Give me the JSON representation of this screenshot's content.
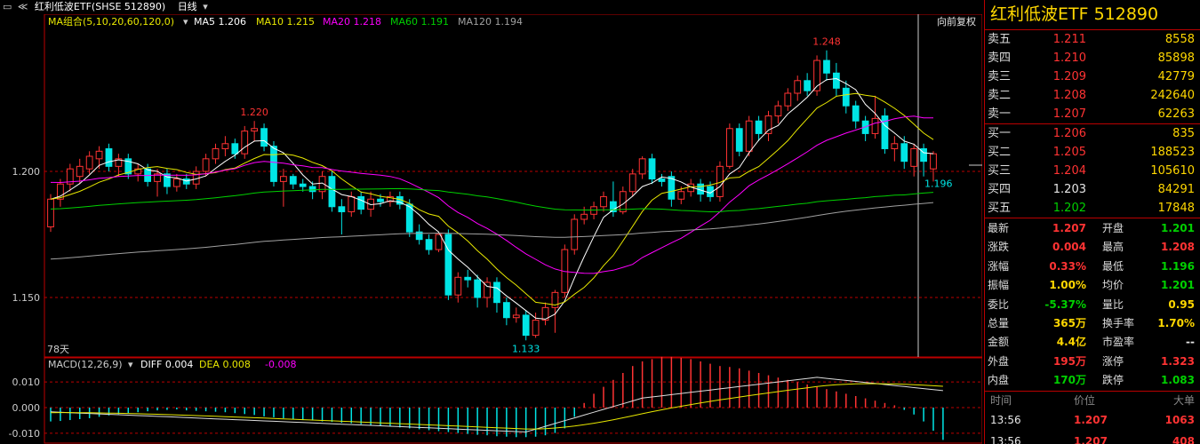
{
  "topbar": {
    "title": "红利低波ETF(SHSE 512890)",
    "period": "日线",
    "ma_group": "MA组合(5,10,20,60,120,0)",
    "ma5": "MA5 1.206",
    "ma10": "MA10 1.215",
    "ma20": "MA20 1.218",
    "ma60": "MA60 1.191",
    "ma120": "MA120 1.194",
    "adjust": "向前复权"
  },
  "chart": {
    "y_labels": [
      "1.200",
      "1.150"
    ],
    "max_label": "1.248",
    "left_high_label": "1.220",
    "min_label": "1.133",
    "last_label": "1.196",
    "days_label": "78天",
    "macd_title": "MACD(12,26,9)",
    "diff": "DIFF 0.004",
    "dea": "DEA 0.008",
    "macd": "-0.008",
    "macd_y": [
      "0.010",
      "0.000",
      "-0.010"
    ],
    "colors": {
      "up": "#ff3333",
      "down": "#00e5e5",
      "ma5": "#ffffff",
      "ma10": "#e8e800",
      "ma20": "#ff00ff",
      "ma60": "#00d000",
      "ma120": "#a0a0a0"
    }
  },
  "chart_data": {
    "type": "candlestick",
    "candles": [
      [
        1.178,
        1.189,
        1.191,
        1.176
      ],
      [
        1.189,
        1.195,
        1.197,
        1.186
      ],
      [
        1.195,
        1.201,
        1.203,
        1.192
      ],
      [
        1.198,
        1.202,
        1.205,
        1.195
      ],
      [
        1.201,
        1.206,
        1.208,
        1.199
      ],
      [
        1.205,
        1.208,
        1.21,
        1.201
      ],
      [
        1.209,
        1.202,
        1.211,
        1.2
      ],
      [
        1.202,
        1.205,
        1.207,
        1.198
      ],
      [
        1.205,
        1.199,
        1.207,
        1.197
      ],
      [
        1.199,
        1.201,
        1.203,
        1.196
      ],
      [
        1.201,
        1.196,
        1.203,
        1.194
      ],
      [
        1.196,
        1.199,
        1.201,
        1.19
      ],
      [
        1.199,
        1.194,
        1.201,
        1.191
      ],
      [
        1.194,
        1.197,
        1.199,
        1.192
      ],
      [
        1.197,
        1.195,
        1.199,
        1.193
      ],
      [
        1.195,
        1.2,
        1.202,
        1.193
      ],
      [
        1.2,
        1.205,
        1.207,
        1.198
      ],
      [
        1.205,
        1.209,
        1.211,
        1.203
      ],
      [
        1.209,
        1.211,
        1.214,
        1.206
      ],
      [
        1.211,
        1.207,
        1.213,
        1.205
      ],
      [
        1.207,
        1.216,
        1.218,
        1.205
      ],
      [
        1.216,
        1.217,
        1.22,
        1.212
      ],
      [
        1.217,
        1.21,
        1.219,
        1.208
      ],
      [
        1.21,
        1.196,
        1.212,
        1.194
      ],
      [
        1.196,
        1.198,
        1.201,
        1.186
      ],
      [
        1.198,
        1.195,
        1.199,
        1.193
      ],
      [
        1.195,
        1.194,
        1.197,
        1.192
      ],
      [
        1.194,
        1.192,
        1.196,
        1.189
      ],
      [
        1.192,
        1.198,
        1.2,
        1.189
      ],
      [
        1.198,
        1.186,
        1.2,
        1.184
      ],
      [
        1.186,
        1.184,
        1.189,
        1.175
      ],
      [
        1.184,
        1.19,
        1.192,
        1.182
      ],
      [
        1.19,
        1.185,
        1.192,
        1.183
      ],
      [
        1.185,
        1.189,
        1.192,
        1.182
      ],
      [
        1.189,
        1.188,
        1.191,
        1.186
      ],
      [
        1.188,
        1.19,
        1.192,
        1.186
      ],
      [
        1.19,
        1.187,
        1.192,
        1.185
      ],
      [
        1.187,
        1.176,
        1.189,
        1.174
      ],
      [
        1.176,
        1.173,
        1.179,
        1.171
      ],
      [
        1.173,
        1.169,
        1.175,
        1.167
      ],
      [
        1.169,
        1.175,
        1.176,
        1.168
      ],
      [
        1.175,
        1.151,
        1.177,
        1.149
      ],
      [
        1.151,
        1.158,
        1.16,
        1.148
      ],
      [
        1.158,
        1.157,
        1.161,
        1.154
      ],
      [
        1.157,
        1.15,
        1.159,
        1.146
      ],
      [
        1.15,
        1.156,
        1.158,
        1.146
      ],
      [
        1.156,
        1.148,
        1.158,
        1.144
      ],
      [
        1.148,
        1.142,
        1.15,
        1.139
      ],
      [
        1.142,
        1.143,
        1.146,
        1.14
      ],
      [
        1.143,
        1.135,
        1.145,
        1.133
      ],
      [
        1.135,
        1.141,
        1.144,
        1.134
      ],
      [
        1.141,
        1.146,
        1.148,
        1.139
      ],
      [
        1.146,
        1.152,
        1.153,
        1.136
      ],
      [
        1.152,
        1.169,
        1.171,
        1.15
      ],
      [
        1.169,
        1.181,
        1.183,
        1.167
      ],
      [
        1.181,
        1.183,
        1.186,
        1.179
      ],
      [
        1.183,
        1.186,
        1.188,
        1.181
      ],
      [
        1.186,
        1.19,
        1.192,
        1.184
      ],
      [
        1.188,
        1.184,
        1.196,
        1.182
      ],
      [
        1.184,
        1.192,
        1.194,
        1.183
      ],
      [
        1.192,
        1.199,
        1.201,
        1.19
      ],
      [
        1.199,
        1.205,
        1.206,
        1.197
      ],
      [
        1.205,
        1.197,
        1.207,
        1.195
      ],
      [
        1.197,
        1.196,
        1.199,
        1.194
      ],
      [
        1.198,
        1.189,
        1.2,
        1.186
      ],
      [
        1.189,
        1.192,
        1.194,
        1.187
      ],
      [
        1.192,
        1.195,
        1.197,
        1.19
      ],
      [
        1.195,
        1.191,
        1.197,
        1.188
      ],
      [
        1.194,
        1.19,
        1.196,
        1.188
      ],
      [
        1.19,
        1.202,
        1.204,
        1.188
      ],
      [
        1.202,
        1.217,
        1.219,
        1.201
      ],
      [
        1.217,
        1.208,
        1.219,
        1.206
      ],
      [
        1.208,
        1.22,
        1.222,
        1.206
      ],
      [
        1.22,
        1.215,
        1.222,
        1.212
      ],
      [
        1.215,
        1.222,
        1.224,
        1.212
      ],
      [
        1.222,
        1.226,
        1.228,
        1.219
      ],
      [
        1.226,
        1.231,
        1.233,
        1.224
      ],
      [
        1.231,
        1.236,
        1.238,
        1.228
      ],
      [
        1.236,
        1.232,
        1.239,
        1.23
      ],
      [
        1.232,
        1.244,
        1.246,
        1.23
      ],
      [
        1.244,
        1.239,
        1.248,
        1.236
      ],
      [
        1.239,
        1.233,
        1.243,
        1.23
      ],
      [
        1.233,
        1.226,
        1.236,
        1.223
      ],
      [
        1.226,
        1.22,
        1.228,
        1.217
      ],
      [
        1.22,
        1.215,
        1.222,
        1.212
      ],
      [
        1.215,
        1.221,
        1.23,
        1.213
      ],
      [
        1.222,
        1.209,
        1.225,
        1.207
      ],
      [
        1.209,
        1.211,
        1.214,
        1.204
      ],
      [
        1.211,
        1.204,
        1.214,
        1.201
      ],
      [
        1.202,
        1.209,
        1.211,
        1.198
      ],
      [
        1.209,
        1.204,
        1.211,
        1.198
      ],
      [
        1.201,
        1.207,
        1.208,
        1.196
      ]
    ],
    "macd_hist": [
      -0.003,
      -0.0029,
      -0.0027,
      -0.0025,
      -0.0023,
      -0.002,
      -0.0017,
      -0.0014,
      -0.0012,
      -0.001,
      -0.0008,
      -0.0006,
      -0.0005,
      -0.0004,
      -0.0006,
      -0.0007,
      -0.0008,
      -0.0009,
      -0.001,
      -0.0012,
      -0.0014,
      -0.0016,
      -0.0019,
      -0.0021,
      -0.0023,
      -0.0025,
      -0.0027,
      -0.0028,
      -0.003,
      -0.0031,
      -0.0033,
      -0.0034,
      -0.0036,
      -0.0038,
      -0.004,
      -0.0041,
      -0.0043,
      -0.0045,
      -0.0047,
      -0.0049,
      -0.0051,
      -0.0053,
      -0.0055,
      -0.0057,
      -0.0059,
      -0.006,
      -0.0062,
      -0.0063,
      -0.0064,
      -0.0064,
      -0.0063,
      -0.006,
      -0.0055,
      -0.0045,
      -0.002,
      0.001,
      0.003,
      0.0045,
      0.006,
      0.0075,
      0.009,
      0.01,
      0.0105,
      0.011,
      0.011,
      0.0108,
      0.0105,
      0.01,
      0.0095,
      0.009,
      0.0088,
      0.0085,
      0.008,
      0.0075,
      0.007,
      0.0065,
      0.006,
      0.0055,
      0.005,
      0.0045,
      0.004,
      0.0035,
      0.003,
      0.0025,
      0.002,
      0.0015,
      0.001,
      0.0005,
      -0.0005,
      -0.0015,
      -0.003,
      -0.005,
      -0.007
    ]
  },
  "panel": {
    "title": "红利低波ETF  512890",
    "asks": [
      {
        "label": "卖五",
        "price": "1.211",
        "vol": "8558"
      },
      {
        "label": "卖四",
        "price": "1.210",
        "vol": "85898"
      },
      {
        "label": "卖三",
        "price": "1.209",
        "vol": "42779"
      },
      {
        "label": "卖二",
        "price": "1.208",
        "vol": "242640"
      },
      {
        "label": "卖一",
        "price": "1.207",
        "vol": "62263"
      }
    ],
    "bids": [
      {
        "label": "买一",
        "price": "1.206",
        "vol": "835"
      },
      {
        "label": "买二",
        "price": "1.205",
        "vol": "188523"
      },
      {
        "label": "买三",
        "price": "1.204",
        "vol": "105610"
      },
      {
        "label": "买四",
        "price": "1.203",
        "vol": "84291"
      },
      {
        "label": "买五",
        "price": "1.202",
        "vol": "17848"
      }
    ],
    "stats": [
      {
        "k1": "最新",
        "v1": "1.207",
        "c1": "red",
        "k2": "开盘",
        "v2": "1.201",
        "c2": "grn"
      },
      {
        "k1": "涨跌",
        "v1": "0.004",
        "c1": "red",
        "k2": "最高",
        "v2": "1.208",
        "c2": "red"
      },
      {
        "k1": "涨幅",
        "v1": "0.33%",
        "c1": "red",
        "k2": "最低",
        "v2": "1.196",
        "c2": "grn"
      },
      {
        "k1": "振幅",
        "v1": "1.00%",
        "c1": "yel",
        "k2": "均价",
        "v2": "1.201",
        "c2": "grn"
      },
      {
        "k1": "委比",
        "v1": "-5.37%",
        "c1": "grn",
        "k2": "量比",
        "v2": "0.95",
        "c2": "yel"
      },
      {
        "k1": "总量",
        "v1": "365万",
        "c1": "yel",
        "k2": "换手率",
        "v2": "1.70%",
        "c2": "yel"
      },
      {
        "k1": "金额",
        "v1": "4.4亿",
        "c1": "yel",
        "k2": "市盈率",
        "v2": "--",
        "c2": "wht"
      },
      {
        "k1": "外盘",
        "v1": "195万",
        "c1": "red",
        "k2": "涨停",
        "v2": "1.323",
        "c2": "red"
      },
      {
        "k1": "内盘",
        "v1": "170万",
        "c1": "grn",
        "k2": "跌停",
        "v2": "1.083",
        "c2": "grn"
      }
    ],
    "ticks_header": {
      "time": "时间",
      "price": "价位",
      "vol": "大单"
    },
    "ticks": [
      {
        "time": "13:56",
        "price": "1.207",
        "vol": "1063"
      },
      {
        "time": "13:56",
        "price": "1.207",
        "vol": "408"
      }
    ]
  }
}
